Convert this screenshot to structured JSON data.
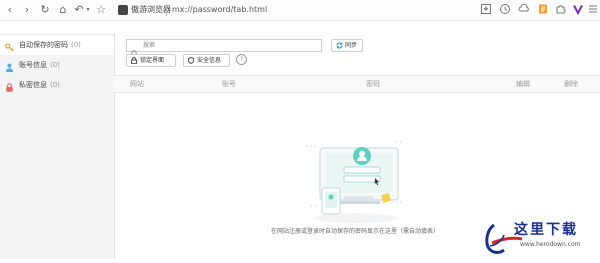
{
  "toolbar": {
    "back": "‹",
    "forward": "›",
    "reload": "↻",
    "home": "⌂",
    "undo": "↶",
    "undo_caret": "▾",
    "star": "☆",
    "site_name": "傲游浏览器",
    "url": "mx://password/tab.html",
    "right_icons": [
      "save-icon",
      "history-icon",
      "cloud-icon",
      "note-icon",
      "puzzle-icon",
      "vivaldi-icon",
      "menu-icon"
    ]
  },
  "sidebar": {
    "items": [
      {
        "label": "自动保存的密码",
        "count": "(0)",
        "icon": "key-icon"
      },
      {
        "label": "账号信息",
        "count": "(0)",
        "icon": "person-icon"
      },
      {
        "label": "私密信息",
        "count": "(0)",
        "icon": "lock-icon"
      }
    ]
  },
  "search": {
    "placeholder": "搜索"
  },
  "buttons": {
    "sync": "同步",
    "lock_page": "锁定界面",
    "security_info": "安全信息",
    "help": "?"
  },
  "table": {
    "columns": [
      "网站",
      "账号",
      "密码",
      "编辑",
      "删除"
    ],
    "rows": []
  },
  "empty_state": {
    "message": "在网站注册或登录时自动保存的密码显示在这里（需自动填表）"
  },
  "watermark": {
    "text": "这里下载",
    "url": "www.herodown.com"
  },
  "colors": {
    "accent": "#2a8fd6",
    "illustration_teal": "#5fd0c0",
    "watermark_blue": "#1a2e8c",
    "key_orange": "#e7a33a"
  }
}
